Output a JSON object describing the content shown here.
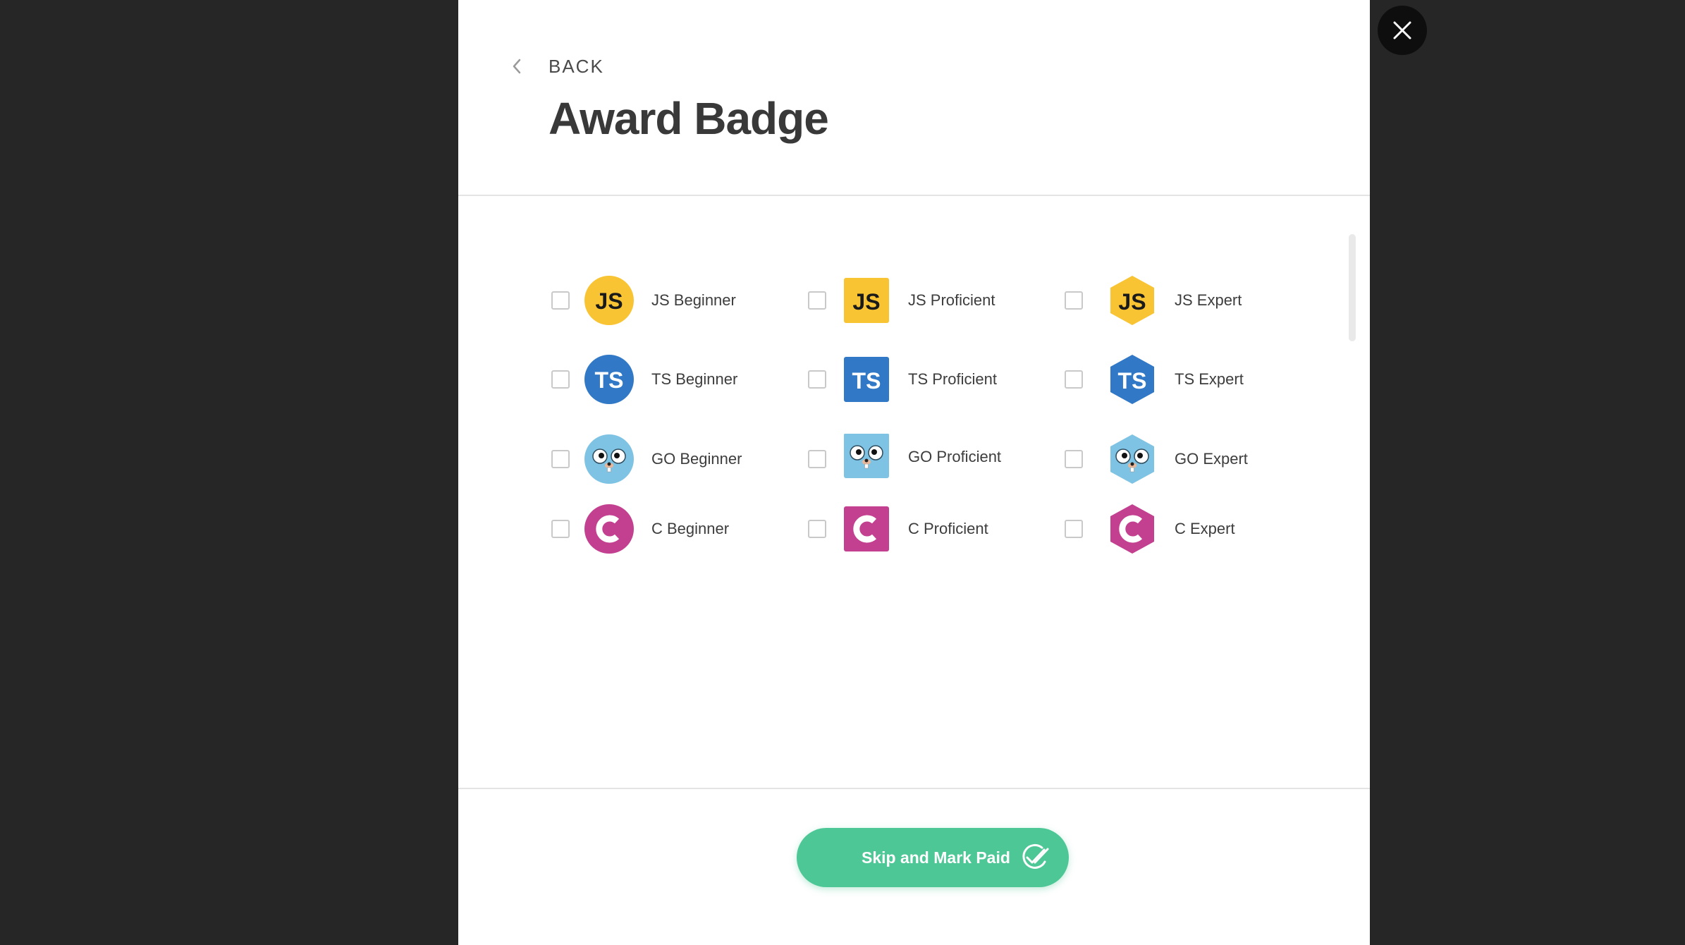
{
  "modal": {
    "back_label": "BACK",
    "title": "Award Badge",
    "badges": [
      [
        {
          "label": "JS Beginner",
          "icon": "js-circle-icon",
          "checked": false
        },
        {
          "label": "JS Proficient",
          "icon": "js-square-icon",
          "checked": false
        },
        {
          "label": "JS Expert",
          "icon": "js-hexagon-icon",
          "checked": false
        }
      ],
      [
        {
          "label": "TS Beginner",
          "icon": "ts-circle-icon",
          "checked": false
        },
        {
          "label": "TS Proficient",
          "icon": "ts-square-icon",
          "checked": false
        },
        {
          "label": "TS Expert",
          "icon": "ts-hexagon-icon",
          "checked": false
        }
      ],
      [
        {
          "label": "GO Beginner",
          "icon": "go-gopher-circle-icon",
          "checked": false
        },
        {
          "label": "GO Proficient",
          "icon": "go-gopher-square-icon",
          "checked": false
        },
        {
          "label": "GO Expert",
          "icon": "go-gopher-hexagon-icon",
          "checked": false
        }
      ],
      [
        {
          "label": "C Beginner",
          "icon": "c-circle-icon",
          "checked": false
        },
        {
          "label": "C Proficient",
          "icon": "c-square-icon",
          "checked": false
        },
        {
          "label": "C Expert",
          "icon": "c-hexagon-icon",
          "checked": false
        }
      ]
    ],
    "primary_button": {
      "label": "Skip and Mark Paid",
      "icon": "double-check-circle-icon"
    }
  },
  "close_icon": "close-icon",
  "colors": {
    "backdrop": "#262626",
    "js": "#f9c433",
    "ts": "#3178c6",
    "go": "#7ec3e4",
    "c": "#c2408f",
    "button": "#4ec796"
  }
}
